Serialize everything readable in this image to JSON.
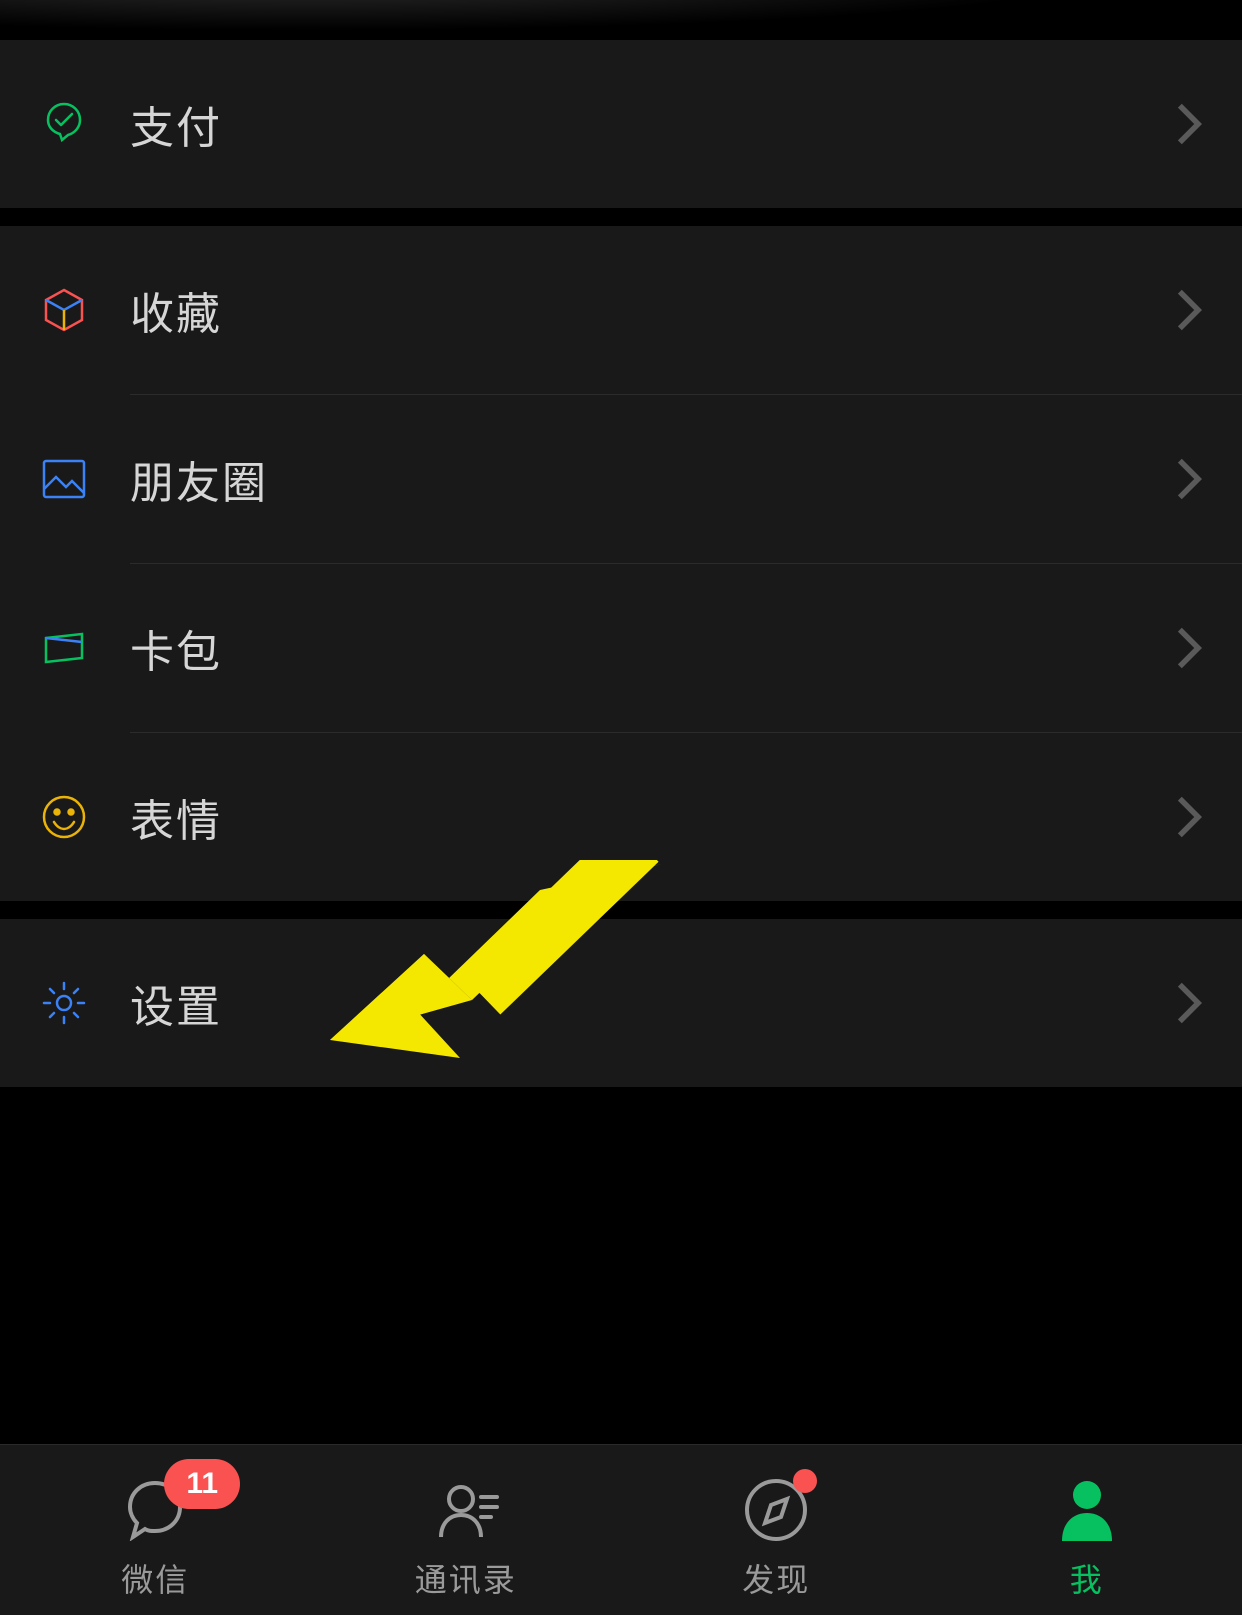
{
  "menu": {
    "pay": "支付",
    "favorites": "收藏",
    "moments": "朋友圈",
    "cards": "卡包",
    "stickers": "表情",
    "settings": "设置"
  },
  "tabs": {
    "chats": "微信",
    "contacts": "通讯录",
    "discover": "发现",
    "me": "我",
    "badge_count": "11"
  },
  "colors": {
    "accent": "#07c160",
    "badge": "#fa5151"
  }
}
